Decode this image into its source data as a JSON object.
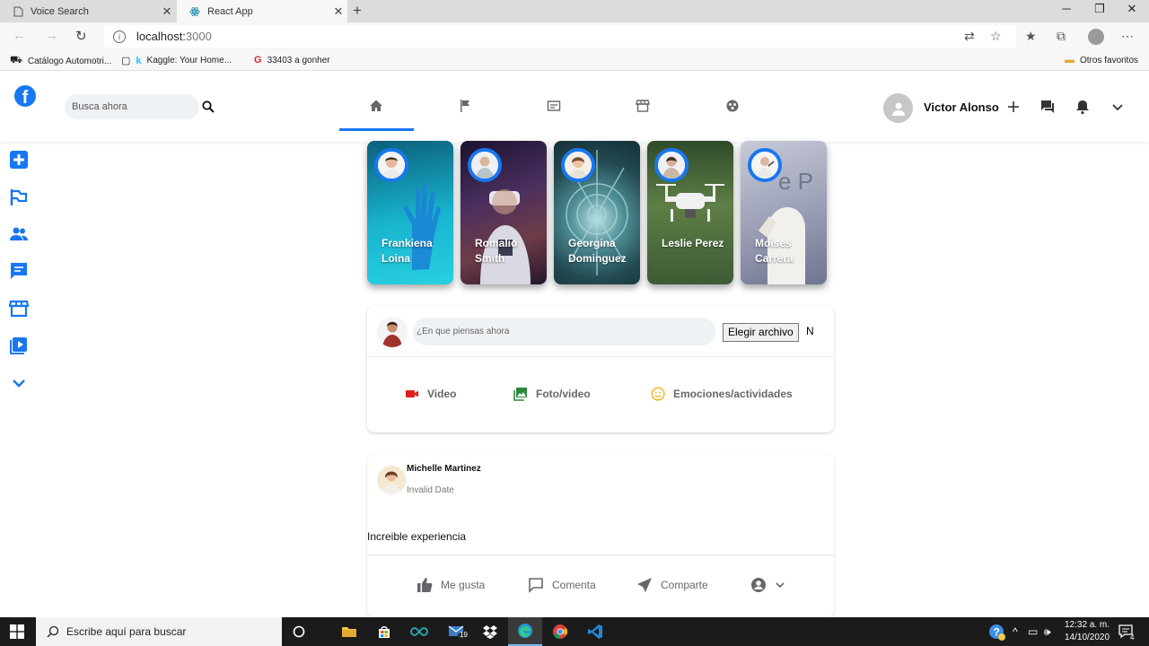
{
  "browser": {
    "tabs": [
      {
        "title": "Voice Search",
        "active": false
      },
      {
        "title": "React App",
        "active": true
      }
    ],
    "url_host": "localhost:",
    "url_port": "3000",
    "bookmarks": [
      "Catálogo Automotri...",
      "Kaggle: Your Home...",
      "33403 a gonher"
    ],
    "other_favorites": "Otros favoritos"
  },
  "header": {
    "search_placeholder": "Busca ahora",
    "user_name": "Victor Alonso"
  },
  "stories": [
    {
      "name": "Frankiena Loina",
      "bg": "#1aa7c4"
    },
    {
      "name": "Romalio Smith",
      "bg": "#3c2a4e"
    },
    {
      "name": "Georgina Dominguez",
      "bg": "#2f5f66"
    },
    {
      "name": "Leslie Perez",
      "bg": "#4c6b3b"
    },
    {
      "name": "Moises Carrera",
      "bg": "#a6a9b8"
    }
  ],
  "composer": {
    "placeholder": "¿En que piensas ahora",
    "file_button": "Elegir archivo",
    "file_status": "N",
    "actions": [
      {
        "label": "Video",
        "icon": "video-camera-icon",
        "color": "#f02849"
      },
      {
        "label": "Foto/video",
        "icon": "photo-icon",
        "color": "#45bd62"
      },
      {
        "label": "Emociones/actividades",
        "icon": "smile-icon",
        "color": "#f7b928"
      }
    ]
  },
  "post": {
    "author": "Michelle Martinez",
    "date": "Invalid Date",
    "text": "Increible experiencia",
    "actions": [
      "Me gusta",
      "Comenta",
      "Comparte"
    ]
  },
  "taskbar": {
    "search_placeholder": "Escribe aquí para buscar",
    "time": "12:32 a. m.",
    "date": "14/10/2020",
    "mail_badge": "19",
    "notif_badge": "4"
  },
  "colors": {
    "accent": "#1877f2",
    "search_bg": "#eff2f5"
  }
}
